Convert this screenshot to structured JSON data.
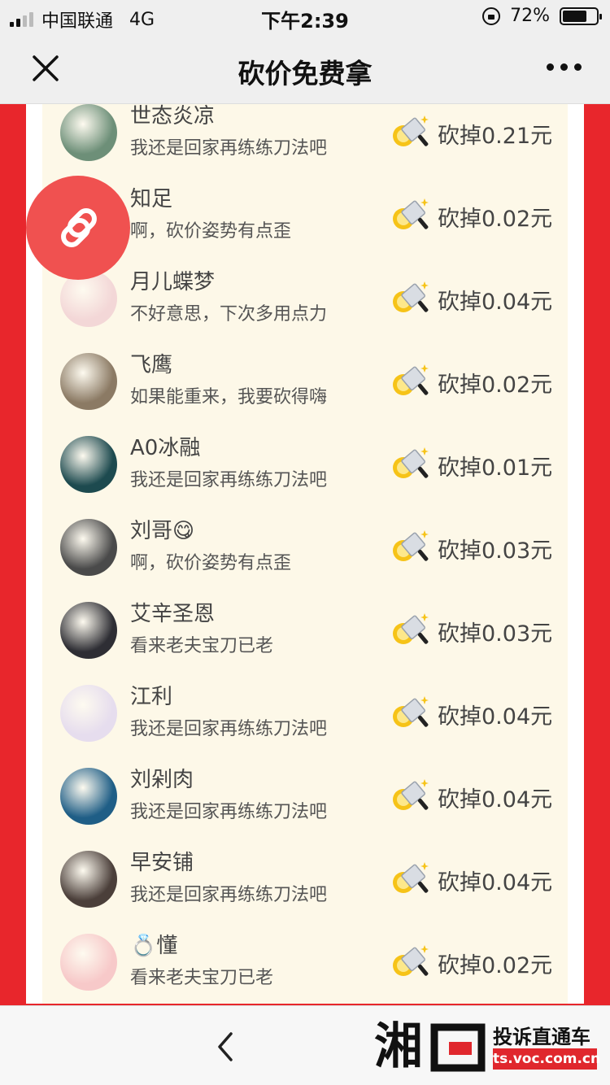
{
  "status": {
    "carrier": "中国联通",
    "network": "4G",
    "time": "下午2:39",
    "battery": "72%"
  },
  "nav": {
    "title": "砍价免费拿",
    "close_icon": "close-icon",
    "more_icon": "more-icon"
  },
  "rows": [
    {
      "name": "世态炎凉",
      "msg": "我还是回家再练练刀法吧",
      "amount": "砍掉0.21元",
      "avatar_color": "#6d8f78"
    },
    {
      "name": "知足",
      "msg": "啊，砍价姿势有点歪",
      "amount": "砍掉0.02元",
      "avatar_color": "#f05150"
    },
    {
      "name": "月儿蝶梦",
      "msg": "不好意思，下次多用点力",
      "amount": "砍掉0.04元",
      "avatar_color": "#f3d7d7"
    },
    {
      "name": "飞鹰",
      "msg": "如果能重来，我要砍得嗨",
      "amount": "砍掉0.02元",
      "avatar_color": "#8b7a64"
    },
    {
      "name": "A0冰融",
      "msg": "我还是回家再练练刀法吧",
      "amount": "砍掉0.01元",
      "avatar_color": "#1d4a4f"
    },
    {
      "name": "刘哥😋",
      "msg": "啊，砍价姿势有点歪",
      "amount": "砍掉0.03元",
      "avatar_color": "#4a4a4a"
    },
    {
      "name": "艾辛圣恩",
      "msg": "看来老夫宝刀已老",
      "amount": "砍掉0.03元",
      "avatar_color": "#2e2e34"
    },
    {
      "name": "江利",
      "msg": "我还是回家再练练刀法吧",
      "amount": "砍掉0.04元",
      "avatar_color": "#e6ddee"
    },
    {
      "name": "刘剁肉",
      "msg": "我还是回家再练练刀法吧",
      "amount": "砍掉0.04元",
      "avatar_color": "#1f5e86"
    },
    {
      "name": "早安铺",
      "msg": "我还是回家再练练刀法吧",
      "amount": "砍掉0.04元",
      "avatar_color": "#4b3f3a"
    },
    {
      "name": "💍懂",
      "msg": "看来老夫宝刀已老",
      "amount": "砍掉0.02元",
      "avatar_color": "#f7c9c9"
    }
  ],
  "brand": {
    "slogan": "投诉直通车",
    "url": "ts.voc.com.cn"
  }
}
